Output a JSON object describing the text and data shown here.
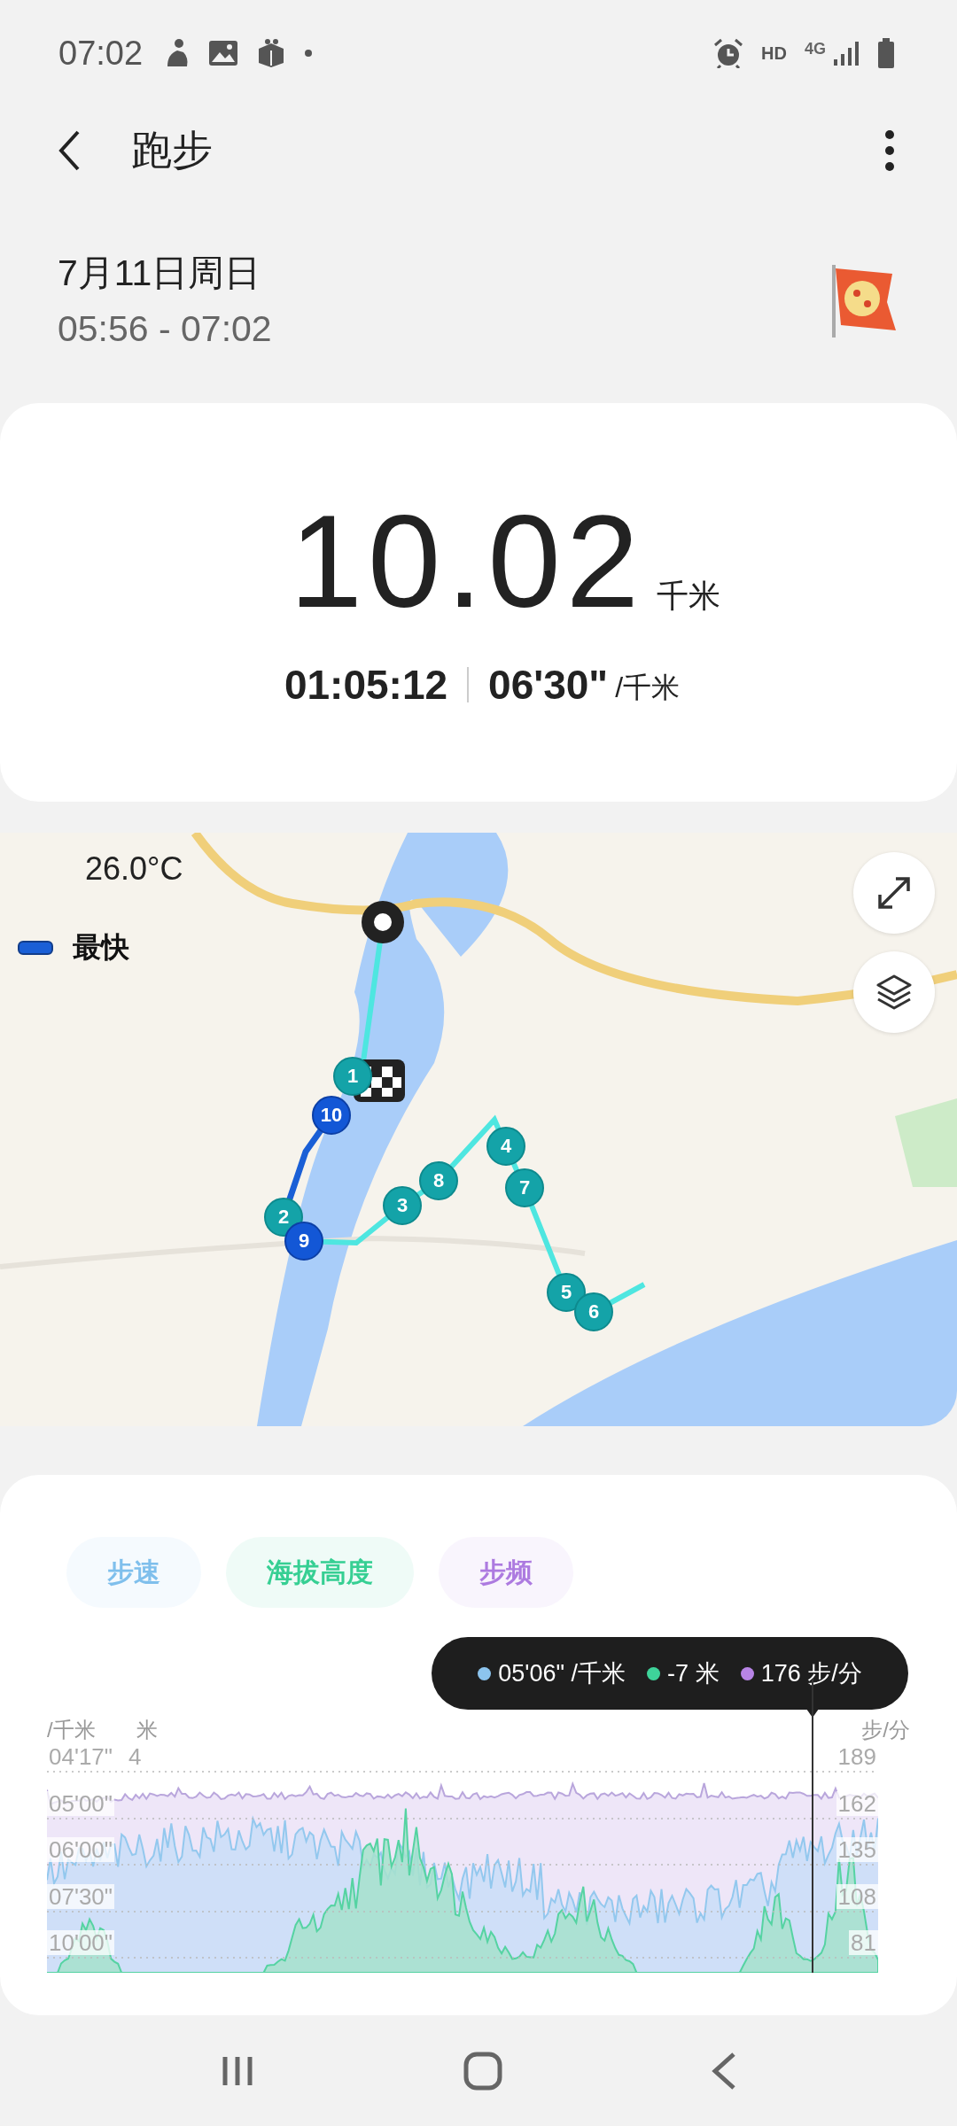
{
  "status_bar": {
    "time": "07:02",
    "hd": "HD",
    "network": "4G"
  },
  "app_bar": {
    "title": "跑步"
  },
  "session": {
    "date": "7月11日周日",
    "time_range": "05:56 - 07:02"
  },
  "summary": {
    "distance": "10.02",
    "distance_unit": "千米",
    "duration": "01:05:12",
    "pace": "06'30\"",
    "pace_unit": "/千米"
  },
  "map": {
    "temperature": "26.0°C",
    "legend": "最快",
    "markers": [
      {
        "label": "1",
        "fastest": false
      },
      {
        "label": "2",
        "fastest": false
      },
      {
        "label": "3",
        "fastest": false
      },
      {
        "label": "4",
        "fastest": false
      },
      {
        "label": "5",
        "fastest": false
      },
      {
        "label": "6",
        "fastest": false
      },
      {
        "label": "7",
        "fastest": false
      },
      {
        "label": "8",
        "fastest": false
      },
      {
        "label": "9",
        "fastest": true
      },
      {
        "label": "10",
        "fastest": true
      }
    ]
  },
  "chart": {
    "tabs": [
      {
        "label": "步速",
        "on": true,
        "color": "#7fbfec"
      },
      {
        "label": "海拔高度",
        "on": true,
        "color": "#36cf93"
      },
      {
        "label": "步频",
        "on": true,
        "color": "#ad7be0"
      }
    ],
    "tooltip": [
      {
        "text": "05'06\" /千米",
        "color": "#8cc4ee"
      },
      {
        "text": "-7 米",
        "color": "#3ed39a"
      },
      {
        "text": "176 步/分",
        "color": "#b884e6"
      }
    ],
    "axis_units": {
      "pace": "/千米",
      "altitude": "米",
      "cadence": "步/分"
    },
    "rows": [
      {
        "pace": "04'17\"",
        "altitude": "4",
        "cadence": "189"
      },
      {
        "pace": "05'00\"",
        "cadence": "162"
      },
      {
        "pace": "06'00\"",
        "cadence": "135"
      },
      {
        "pace": "07'30\"",
        "cadence": "108"
      },
      {
        "pace": "10'00\"",
        "cadence": "81"
      }
    ]
  }
}
